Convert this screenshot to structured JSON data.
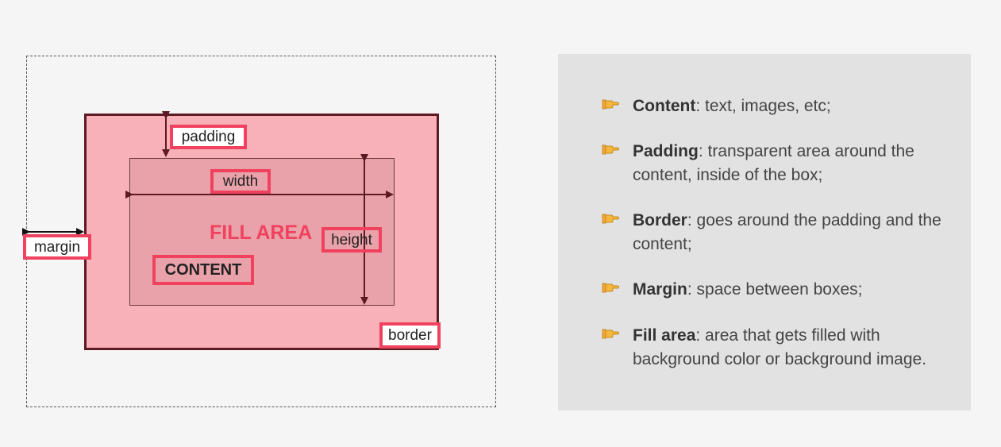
{
  "diagram": {
    "labels": {
      "padding": "padding",
      "width": "width",
      "fill_area": "FILL AREA",
      "height": "height",
      "margin": "margin",
      "content": "CONTENT",
      "border": "border"
    },
    "colors": {
      "accent": "#f0425f",
      "border_fill": "#f9b1b9",
      "content_fill": "#eaa2aa",
      "border_line": "#5d1a22"
    }
  },
  "panel": {
    "items": [
      {
        "term": "Content",
        "desc": ": text, images, etc;",
        "icon": "pointing-hand-icon"
      },
      {
        "term": "Padding",
        "desc": ": transparent area around the content, inside of the box;",
        "icon": "pointing-hand-icon"
      },
      {
        "term": "Border",
        "desc": ": goes around the padding and the content;",
        "icon": "pointing-hand-icon"
      },
      {
        "term": "Margin",
        "desc": ": space between boxes;",
        "icon": "pointing-hand-icon"
      },
      {
        "term": "Fill area",
        "desc": ": area that gets filled with background color or background image.",
        "icon": "pointing-hand-icon"
      }
    ]
  }
}
